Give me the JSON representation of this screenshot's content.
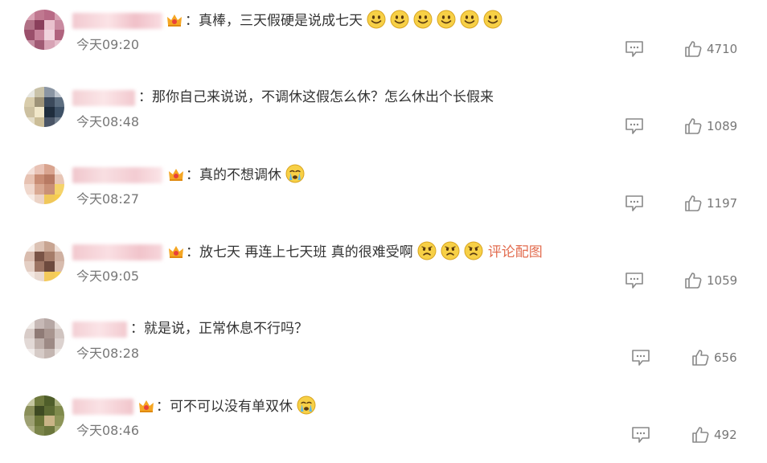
{
  "comments": [
    {
      "text": "：真棒，三天假硬是说成七天",
      "time": "今天09:20",
      "likes": "4710",
      "emojis": [
        "smile",
        "smile",
        "smile",
        "smile",
        "smile",
        "smile"
      ],
      "vip": true,
      "pic_link": ""
    },
    {
      "text": "：那你自己来说说，不调休这假怎么休？怎么休出个长假来",
      "time": "今天08:48",
      "likes": "1089",
      "emojis": [],
      "vip": false,
      "pic_link": ""
    },
    {
      "text": "：真的不想调休",
      "time": "今天08:27",
      "likes": "1197",
      "emojis": [
        "cry"
      ],
      "vip": true,
      "pic_link": ""
    },
    {
      "text": "：放七天 再连上七天班 真的很难受啊",
      "time": "今天09:05",
      "likes": "1059",
      "emojis": [
        "sad",
        "sad",
        "sad"
      ],
      "vip": true,
      "pic_link": "评论配图"
    },
    {
      "text": "：就是说，正常休息不行吗？",
      "time": "今天08:28",
      "likes": "656",
      "emojis": [],
      "vip": false,
      "pic_link": ""
    },
    {
      "text": "：可不可以没有单双休",
      "time": "今天08:46",
      "likes": "492",
      "emojis": [
        "cry"
      ],
      "vip": true,
      "pic_link": ""
    }
  ],
  "colors": {
    "link": "#e26c4f",
    "text": "#333333",
    "meta": "#777777",
    "vip_gold": "#f5a623",
    "vip_red": "#e8413a"
  }
}
